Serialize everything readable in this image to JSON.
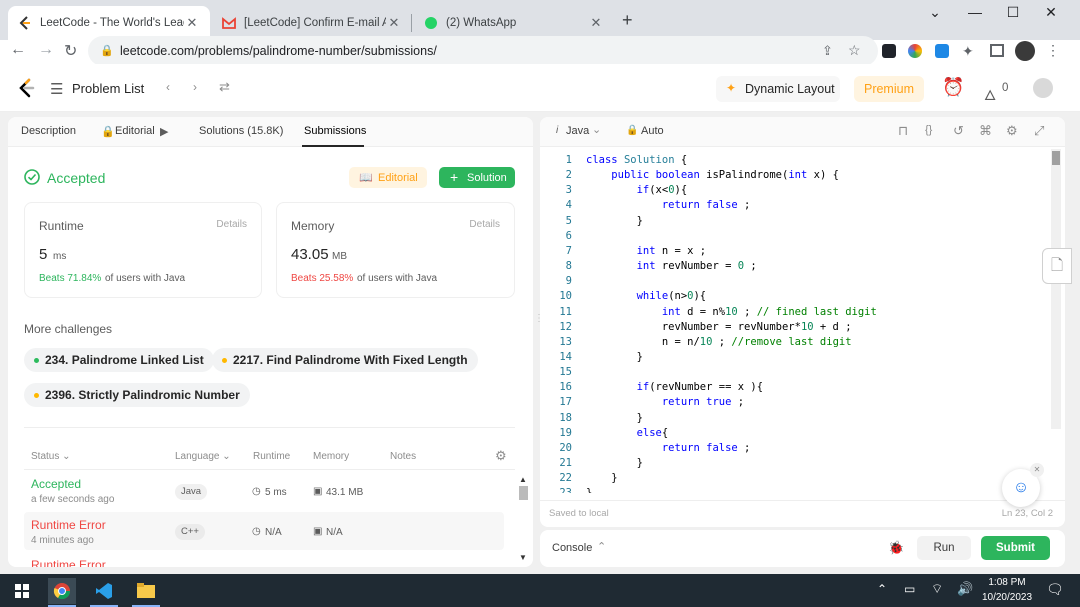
{
  "browser": {
    "tabs": [
      {
        "title": "LeetCode - The World's Leading",
        "active": true
      },
      {
        "title": "[LeetCode] Confirm E-mail Addre",
        "active": false
      },
      {
        "title": "(2) WhatsApp",
        "active": false
      }
    ],
    "new_tab": "+",
    "url": "leetcode.com/problems/palindrome-number/submissions/"
  },
  "header": {
    "problem_list": "Problem List",
    "dynamic_layout": "Dynamic Layout",
    "premium": "Premium",
    "streak": "0"
  },
  "left": {
    "tabs": [
      "Description",
      "Editorial",
      "Solutions (15.8K)",
      "Submissions"
    ],
    "status": "Accepted",
    "editorial_btn": "Editorial",
    "solution_btn": "Solution",
    "runtime": {
      "label": "Runtime",
      "details": "Details",
      "value": "5",
      "unit": "ms",
      "beats": "Beats 71.84%",
      "suffix": "of users with Java"
    },
    "memory": {
      "label": "Memory",
      "details": "Details",
      "value": "43.05",
      "unit": "MB",
      "beats": "Beats 25.58%",
      "suffix": "of users with Java"
    },
    "more_challenges": "More challenges",
    "challenges": [
      {
        "label": "234. Palindrome Linked List",
        "color": "#2cbb5d"
      },
      {
        "label": "2217. Find Palindrome With Fixed Length",
        "color": "#ffb800"
      },
      {
        "label": "2396. Strictly Palindromic Number",
        "color": "#ffb800"
      }
    ],
    "table_headers": [
      "Status",
      "Language",
      "Runtime",
      "Memory",
      "Notes"
    ],
    "rows": [
      {
        "status": "Accepted",
        "time": "a few seconds ago",
        "lang": "Java",
        "runtime": "5 ms",
        "memory": "43.1 MB",
        "status_color": "#2db55d"
      },
      {
        "status": "Runtime Error",
        "time": "4 minutes ago",
        "lang": "C++",
        "runtime": "N/A",
        "memory": "N/A",
        "status_color": "#ef4743"
      },
      {
        "status": "Runtime Error",
        "time": "",
        "lang": "",
        "runtime": "",
        "memory": "",
        "status_color": "#ef4743"
      }
    ]
  },
  "editor": {
    "language": "Java",
    "autosave": "Auto",
    "lines": [
      "class Solution {",
      "    public boolean isPalindrome(int x) {",
      "        if(x<0){",
      "            return false ;",
      "        }",
      "",
      "        int n = x ;",
      "        int revNumber = 0 ;",
      "",
      "        while(n>0){",
      "            int d = n%10 ; // fined last digit",
      "            revNumber = revNumber*10 + d ;",
      "            n = n/10 ; //remove last digit",
      "        }",
      "",
      "        if(revNumber == x ){",
      "            return true ;",
      "        }",
      "        else{",
      "            return false ;",
      "        }",
      "    }",
      "}"
    ],
    "saved": "Saved to local",
    "cursor": "Ln 23, Col 2"
  },
  "console": {
    "label": "Console",
    "run": "Run",
    "submit": "Submit"
  },
  "taskbar": {
    "time": "1:08 PM",
    "date": "10/20/2023"
  }
}
